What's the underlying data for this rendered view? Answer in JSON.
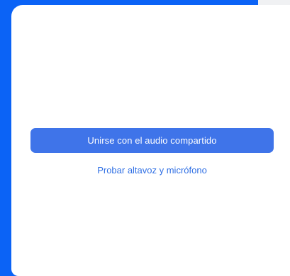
{
  "dialog": {
    "join_audio_label": "Unirse con el audio compartido",
    "test_audio_label": "Probar altavoz y micrófono"
  },
  "colors": {
    "background_blue": "#0b63f6",
    "button_blue": "#3f74e9",
    "link_blue": "#2f6fe4",
    "dialog_white": "#ffffff"
  }
}
